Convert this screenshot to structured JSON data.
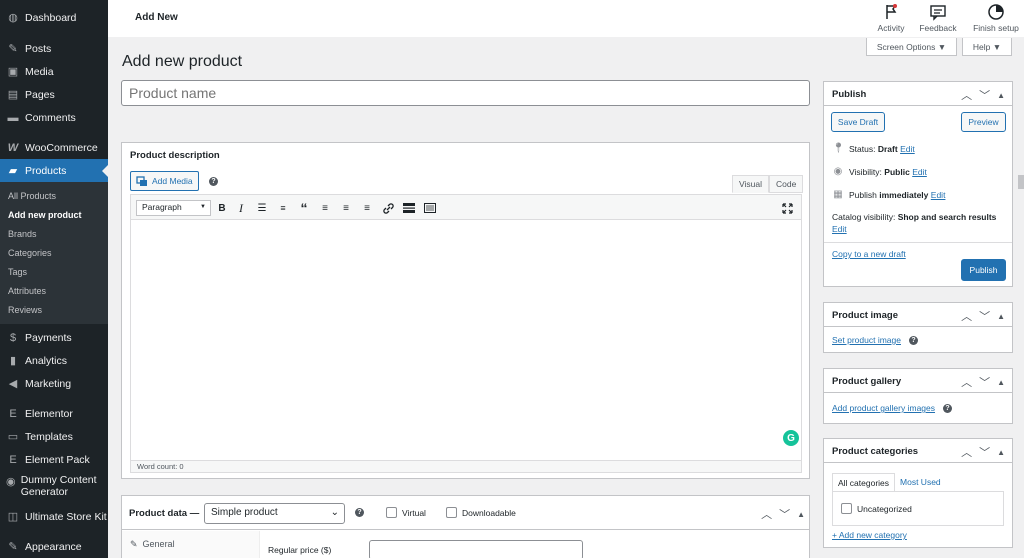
{
  "sidebar": {
    "items": [
      {
        "icon": "dashboard-icon",
        "glyph": "◍",
        "label": "Dashboard"
      },
      {
        "icon": "posts-icon",
        "glyph": "✎",
        "label": "Posts"
      },
      {
        "icon": "media-icon",
        "glyph": "▣",
        "label": "Media"
      },
      {
        "icon": "pages-icon",
        "glyph": "▤",
        "label": "Pages"
      },
      {
        "icon": "comments-icon",
        "glyph": "▬",
        "label": "Comments"
      },
      {
        "icon": "woocommerce-icon",
        "glyph": "W",
        "label": "WooCommerce"
      },
      {
        "icon": "products-icon",
        "glyph": "▰",
        "label": "Products"
      },
      {
        "icon": "payments-icon",
        "glyph": "$",
        "label": "Payments"
      },
      {
        "icon": "analytics-icon",
        "glyph": "▮",
        "label": "Analytics"
      },
      {
        "icon": "marketing-icon",
        "glyph": "◀",
        "label": "Marketing"
      },
      {
        "icon": "elementor-icon",
        "glyph": "E",
        "label": "Elementor"
      },
      {
        "icon": "templates-icon",
        "glyph": "▭",
        "label": "Templates"
      },
      {
        "icon": "element-pack-icon",
        "glyph": "E",
        "label": "Element Pack"
      },
      {
        "icon": "dummy-content-icon",
        "glyph": "◉",
        "label": "Dummy Content Generator"
      },
      {
        "icon": "ultimate-store-kit-icon",
        "glyph": "◫",
        "label": "Ultimate Store Kit"
      },
      {
        "icon": "appearance-icon",
        "glyph": "✎",
        "label": "Appearance"
      }
    ],
    "submenu": [
      "All Products",
      "Add new product",
      "Brands",
      "Categories",
      "Tags",
      "Attributes",
      "Reviews"
    ]
  },
  "topbar": {
    "page_title": "Add New",
    "activity": "Activity",
    "feedback": "Feedback",
    "finish_setup": "Finish setup",
    "screen_options": "Screen Options ▼",
    "help": "Help ▼"
  },
  "page": {
    "title": "Add new product",
    "product_name_placeholder": "Product name"
  },
  "description": {
    "heading": "Product description",
    "add_media": "Add Media",
    "tab_visual": "Visual",
    "tab_code": "Code",
    "format": "Paragraph",
    "word_count": "Word count: 0"
  },
  "product_data": {
    "heading": "Product data —",
    "type": "Simple product",
    "virtual": "Virtual",
    "downloadable": "Downloadable",
    "general_tab": "General",
    "regular_price_label": "Regular price ($)"
  },
  "publish": {
    "heading": "Publish",
    "save_draft": "Save Draft",
    "preview": "Preview",
    "status_label": "Status:",
    "status_value": "Draft",
    "visibility_label": "Visibility:",
    "visibility_value": "Public",
    "publish_label": "Publish",
    "publish_value": "immediately",
    "edit": "Edit",
    "catalog_label": "Catalog visibility:",
    "catalog_value": "Shop and search results",
    "copy_draft": "Copy to a new draft",
    "publish_button": "Publish"
  },
  "product_image": {
    "heading": "Product image",
    "link": "Set product image"
  },
  "product_gallery": {
    "heading": "Product gallery",
    "link": "Add product gallery images"
  },
  "categories": {
    "heading": "Product categories",
    "tab_all": "All categories",
    "tab_used": "Most Used",
    "item": "Uncategorized",
    "add_new": "+ Add new category"
  },
  "colors": {
    "accent": "#2271b1",
    "sidebar_bg": "#1d2327",
    "page_bg": "#f0f0f1"
  }
}
